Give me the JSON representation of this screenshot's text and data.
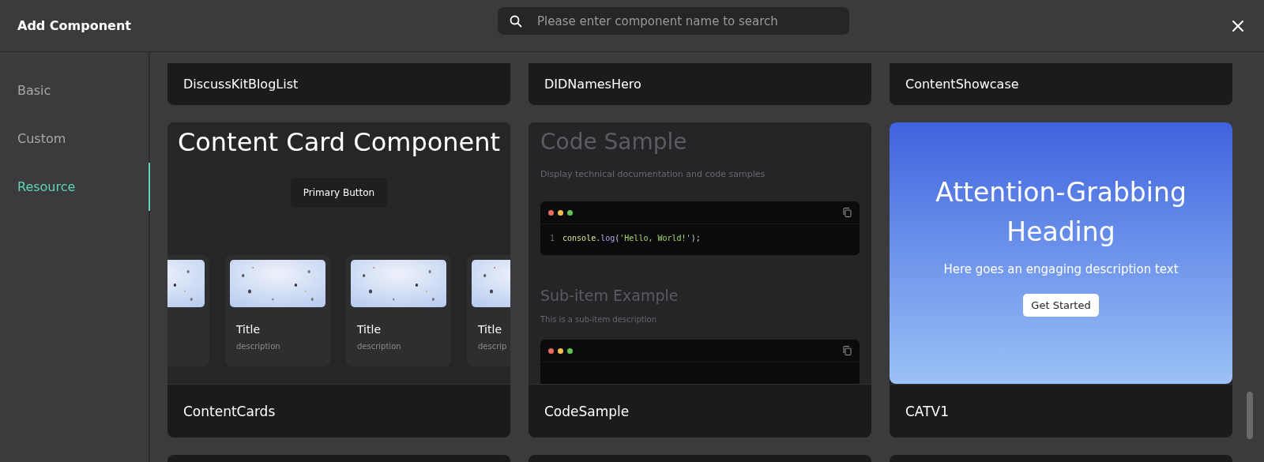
{
  "header": {
    "title": "Add Component",
    "search": {
      "placeholder": "Please enter component name to search"
    }
  },
  "sidebar": {
    "items": [
      {
        "label": "Basic",
        "selected": false
      },
      {
        "label": "Custom",
        "selected": false
      },
      {
        "label": "Resource",
        "selected": true
      }
    ]
  },
  "top_row": [
    {
      "name": "DiscussKitBlogList"
    },
    {
      "name": "DIDNamesHero"
    },
    {
      "name": "ContentShowcase"
    }
  ],
  "cards": [
    {
      "kind": "content-cards",
      "name": "ContentCards",
      "preview": {
        "heading": "Content Card Component",
        "button": "Primary Button",
        "items": [
          {
            "kind": "picture"
          },
          {
            "kind": "picture",
            "title": "Title",
            "description": "description"
          },
          {
            "kind": "picture",
            "title": "Title",
            "description": "description"
          },
          {
            "kind": "picture",
            "title": "Title",
            "description": "descrip"
          }
        ]
      }
    },
    {
      "kind": "code-sample",
      "name": "CodeSample",
      "preview": {
        "heading": "Code Sample",
        "description": "Display technical documentation and code samples",
        "blocks": [
          {
            "lines": [
              {
                "number": "1",
                "tokens": [
                  {
                    "kind": "name",
                    "text": "console"
                  },
                  {
                    "kind": "punct",
                    "text": "."
                  },
                  {
                    "kind": "method",
                    "text": "log"
                  },
                  {
                    "kind": "punct",
                    "text": "("
                  },
                  {
                    "kind": "string",
                    "text": "'Hello, World!'"
                  },
                  {
                    "kind": "punct",
                    "text": ");"
                  }
                ]
              }
            ]
          }
        ],
        "subheading": "Sub-item Example",
        "subdescription": "This is a sub-item description"
      }
    },
    {
      "kind": "hero",
      "name": "CATV1",
      "preview": {
        "heading": "Attention-Grabbing Heading",
        "description": "Here goes an engaging description text",
        "button": "Get Started"
      }
    }
  ]
}
